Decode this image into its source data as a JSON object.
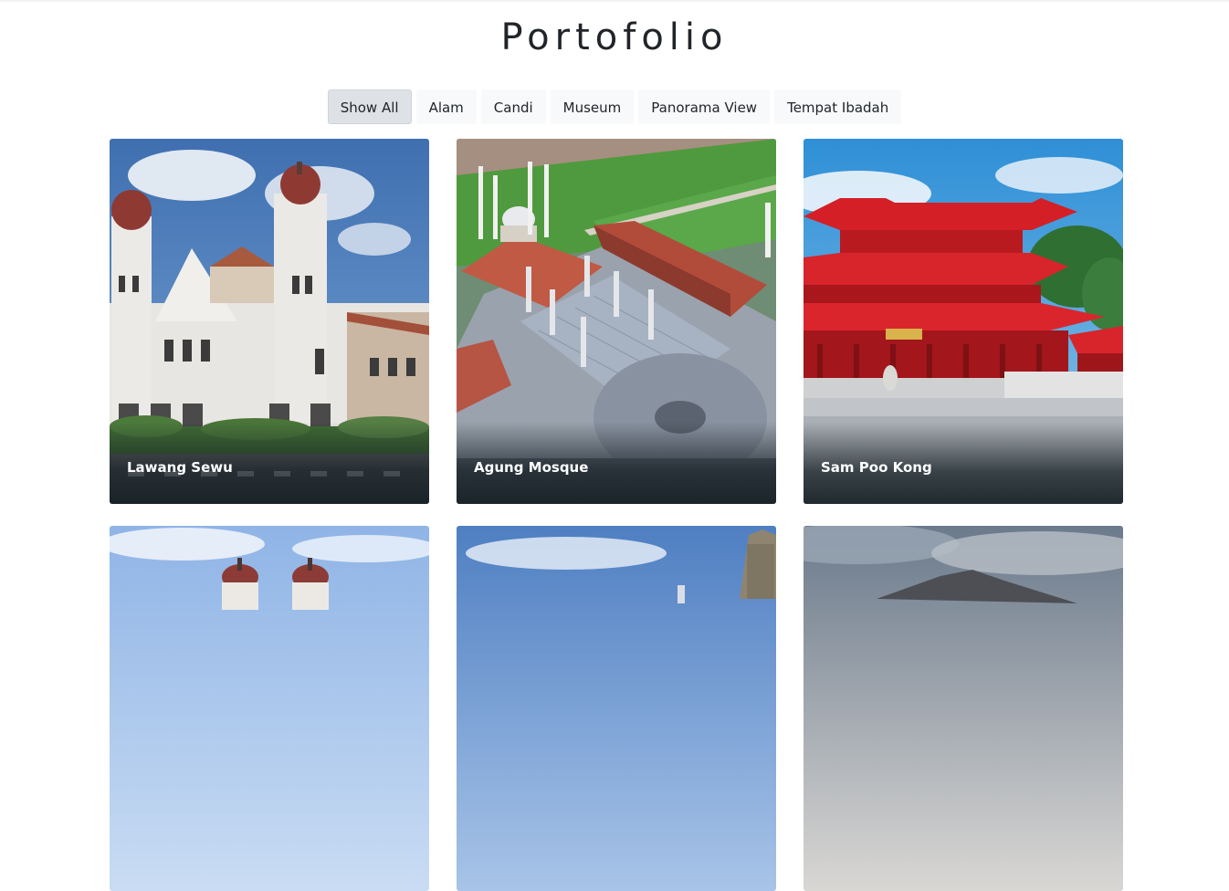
{
  "page": {
    "title": "Portofolio"
  },
  "filters": [
    {
      "label": "Show All",
      "active": true
    },
    {
      "label": "Alam",
      "active": false
    },
    {
      "label": "Candi",
      "active": false
    },
    {
      "label": "Museum",
      "active": false
    },
    {
      "label": "Panorama View",
      "active": false
    },
    {
      "label": "Tempat Ibadah",
      "active": false
    }
  ],
  "portfolio": {
    "items": [
      {
        "caption": "Lawang Sewu"
      },
      {
        "caption": "Agung Mosque"
      },
      {
        "caption": "Sam Poo Kong"
      }
    ]
  }
}
